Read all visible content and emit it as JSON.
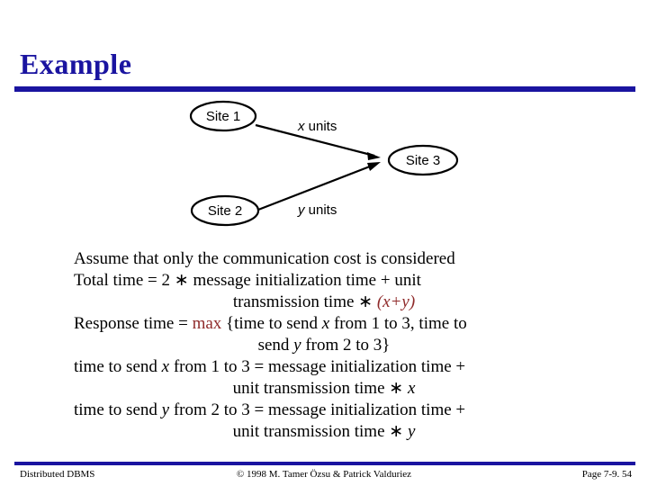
{
  "slide": {
    "title": "Example",
    "accent_color": "#1a14a0",
    "highlight_color": "#8f2a2a",
    "background_color": "#ffffff"
  },
  "diagram": {
    "nodes": [
      {
        "id": "site1",
        "label": "Site 1"
      },
      {
        "id": "site2",
        "label": "Site 2"
      },
      {
        "id": "site3",
        "label": "Site 3"
      }
    ],
    "edges": [
      {
        "from": "site1",
        "to": "site3",
        "label_var": "x",
        "label_unit": " units"
      },
      {
        "from": "site2",
        "to": "site3",
        "label_var": "y",
        "label_unit": " units"
      }
    ]
  },
  "body": {
    "lines": [
      {
        "align": "left",
        "indent": false,
        "parts": [
          {
            "text": "Assume that only the communication cost is considered",
            "style": "plain"
          }
        ]
      },
      {
        "align": "left",
        "indent": false,
        "parts": [
          {
            "text": "Total time = 2 ",
            "style": "plain"
          },
          {
            "text": "∗",
            "style": "plain"
          },
          {
            "text": " message initialization time + unit",
            "style": "plain"
          }
        ]
      },
      {
        "align": "center",
        "indent": false,
        "parts": [
          {
            "text": "transmission time ",
            "style": "plain"
          },
          {
            "text": "∗",
            "style": "plain"
          },
          {
            "text": " ",
            "style": "plain"
          },
          {
            "text": "(x+y)",
            "style": "highlight-italic"
          }
        ]
      },
      {
        "align": "left",
        "indent": false,
        "parts": [
          {
            "text": "Response time = ",
            "style": "plain"
          },
          {
            "text": "max",
            "style": "highlight"
          },
          {
            "text": " {time to send ",
            "style": "plain"
          },
          {
            "text": "x",
            "style": "italic"
          },
          {
            "text": " from 1 to 3, time to",
            "style": "plain"
          }
        ]
      },
      {
        "align": "center",
        "indent": false,
        "parts": [
          {
            "text": "send ",
            "style": "plain"
          },
          {
            "text": "y",
            "style": "italic"
          },
          {
            "text": " from 2 to 3}",
            "style": "plain"
          }
        ]
      },
      {
        "align": "left",
        "indent": false,
        "parts": [
          {
            "text": "time to send ",
            "style": "plain"
          },
          {
            "text": "x",
            "style": "italic"
          },
          {
            "text": " from 1 to 3 = message initialization time +",
            "style": "plain"
          }
        ]
      },
      {
        "align": "center",
        "indent": false,
        "parts": [
          {
            "text": "unit transmission time ",
            "style": "plain"
          },
          {
            "text": "∗",
            "style": "plain"
          },
          {
            "text": " ",
            "style": "plain"
          },
          {
            "text": "x",
            "style": "italic"
          }
        ]
      },
      {
        "align": "left",
        "indent": false,
        "parts": [
          {
            "text": "time to send ",
            "style": "plain"
          },
          {
            "text": "y",
            "style": "italic"
          },
          {
            "text": " from 2 to 3 = message initialization time +",
            "style": "plain"
          }
        ]
      },
      {
        "align": "center",
        "indent": false,
        "parts": [
          {
            "text": "unit transmission time ",
            "style": "plain"
          },
          {
            "text": "∗",
            "style": "plain"
          },
          {
            "text": " ",
            "style": "plain"
          },
          {
            "text": "y",
            "style": "italic"
          }
        ]
      }
    ]
  },
  "footer": {
    "left": "Distributed DBMS",
    "center": "© 1998 M. Tamer Özsu & Patrick Valduriez",
    "right": "Page 7-9. 54"
  }
}
